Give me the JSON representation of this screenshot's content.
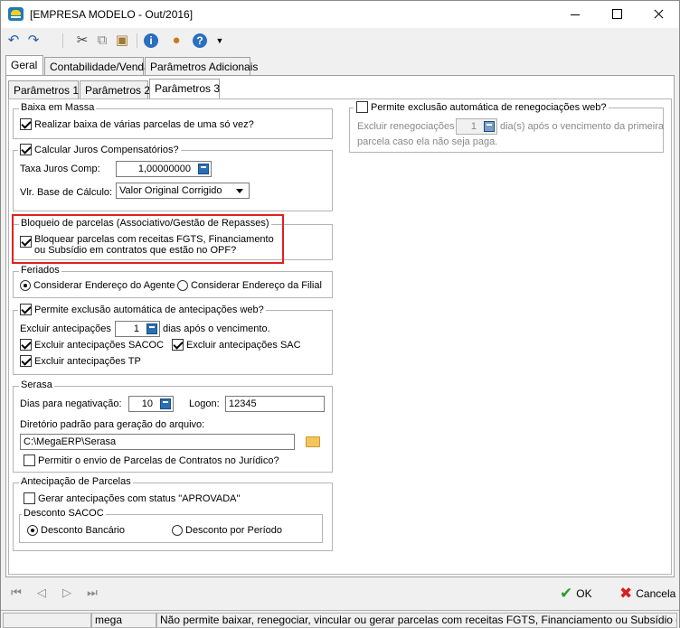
{
  "window": {
    "title": "[EMPRESA MODELO - Out/2016]"
  },
  "top_tabs": [
    {
      "label": "Geral"
    },
    {
      "label": "Contabilidade/Venda"
    },
    {
      "label": "Parâmetros Adicionais"
    }
  ],
  "sub_tabs": [
    {
      "label": "Parâmetros 1"
    },
    {
      "label": "Parâmetros 2"
    },
    {
      "label": "Parâmetros 3"
    }
  ],
  "baixa_massa": {
    "title": "Baixa em Massa",
    "checkbox_label": "Realizar baixa de várias parcelas de uma só vez?",
    "checked": true
  },
  "juros": {
    "checkbox_label": "Calcular Juros Compensatórios?",
    "checked": true,
    "taxa_label": "Taxa Juros Comp:",
    "taxa_value": "1,00000000",
    "base_label": "Vlr. Base de Cálculo:",
    "base_value": "Valor Original Corrigido"
  },
  "bloqueio": {
    "title": "Bloqueio de parcelas (Associativo/Gestão de Repasses)",
    "checkbox_line1": "Bloquear parcelas com receitas FGTS, Financiamento",
    "checkbox_line2": "ou Subsídio em contratos que estão no OPF?",
    "checked": true
  },
  "feriados": {
    "title": "Feriados",
    "option1": "Considerar Endereço do Agente",
    "option2": "Considerar Endereço da Filial",
    "selected": "option1"
  },
  "antecipacoes": {
    "checkbox_label": "Permite exclusão automática de antecipações web?",
    "checked": true,
    "excluir_label": "Excluir antecipações",
    "excluir_value": "1",
    "dias_label": "dias após o vencimento.",
    "sacoc_label": "Excluir antecipações SACOC",
    "sac_label": "Excluir antecipações SAC",
    "tp_label": "Excluir antecipações TP"
  },
  "serasa": {
    "title": "Serasa",
    "dias_label": "Dias para negativação:",
    "dias_value": "10",
    "logon_label": "Logon:",
    "logon_value": "12345",
    "dir_label": "Diretório padrão para geração do arquivo:",
    "dir_value": "C:\\MegaERP\\Serasa",
    "juridico_label": "Permitir o envio de Parcelas de Contratos no Jurídico?"
  },
  "antecipacao_parcelas": {
    "title": "Antecipação de Parcelas",
    "aprovada_label": "Gerar antecipações com status \"APROVADA\"",
    "desconto_title": "Desconto SACOC",
    "desconto_bancario": "Desconto Bancário",
    "desconto_periodo": "Desconto por Período"
  },
  "renegociacoes": {
    "checkbox_label": "Permite exclusão automática de renegociações web?",
    "excluir_label": "Excluir renegociações",
    "excluir_value": "1",
    "dias_line1": "dia(s) após o vencimento da primeira",
    "dias_line2": "parcela caso ela não seja paga."
  },
  "buttons": {
    "ok": "OK",
    "cancel": "Cancela"
  },
  "status": {
    "user": "mega",
    "message": "Não permite baixar, renegociar, vincular ou gerar parcelas com receitas FGTS, Financiamento ou Subsídio e"
  },
  "colors": {
    "highlight": "#e02020",
    "ok_check": "#2f9a2f",
    "cancel_x": "#d62020"
  }
}
